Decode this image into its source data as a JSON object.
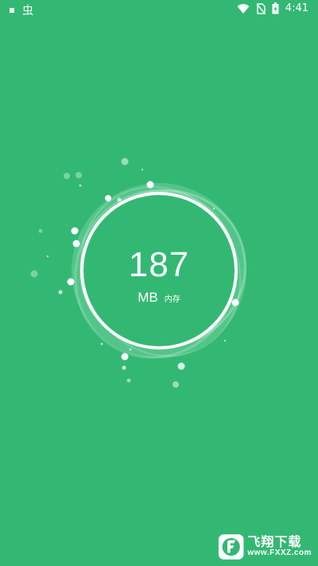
{
  "status_bar": {
    "app_glyph": "虫",
    "time": "4:41",
    "icons": [
      "notification-square-icon",
      "wifi-icon",
      "no-sim-icon",
      "battery-icon"
    ]
  },
  "memory": {
    "value": "187",
    "unit": "MB",
    "label": "内存"
  },
  "watermark": {
    "title": "飞翔下载",
    "subtitle": "www.FXXZ.com"
  },
  "colors": {
    "background": "#33b873",
    "ring": "#ffffff",
    "ring_glow": "#8fdcb3"
  }
}
